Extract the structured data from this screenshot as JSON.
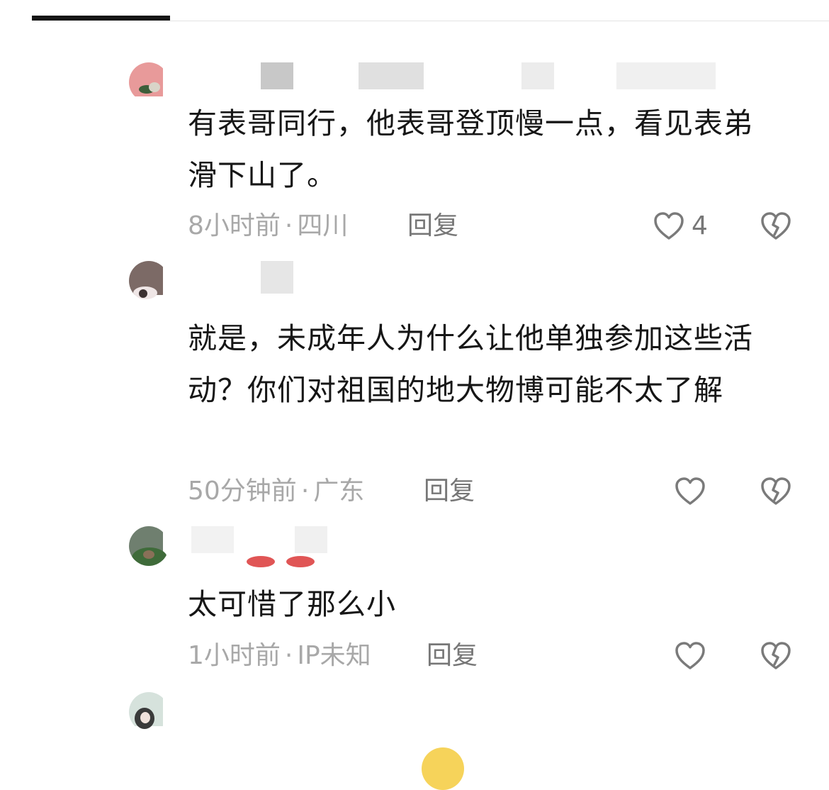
{
  "comments": [
    {
      "text": "有表哥同行，他表哥登顶慢一点，看见表弟滑下山了。",
      "time": "8小时前",
      "location": "四川",
      "reply_label": "回复",
      "like_count": "4"
    },
    {
      "text": "就是，未成年人为什么让他单独参加这些活动？你们对祖国的地大物博可能不太了解",
      "time": "50分钟前",
      "location": "广东",
      "reply_label": "回复",
      "like_count": ""
    },
    {
      "text": "太可惜了那么小",
      "time": "1小时前",
      "location": "IP未知",
      "reply_label": "回复",
      "like_count": ""
    }
  ],
  "colors": {
    "text": "#161616",
    "meta": "#a8a8a8",
    "reply": "#777777",
    "icon": "#7a7a7a"
  },
  "icons": {
    "like": "heart-outline-icon",
    "dislike": "broken-heart-icon"
  }
}
